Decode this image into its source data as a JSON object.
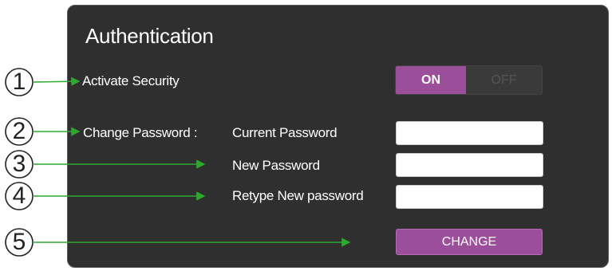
{
  "title": "Authentication",
  "security": {
    "label": "Activate Security",
    "on_label": "ON",
    "off_label": "OFF",
    "state": "on"
  },
  "password": {
    "section_label": "Change Password :",
    "current_label": "Current Password",
    "new_label": "New Password",
    "retype_label": "Retype New password",
    "current_value": "",
    "new_value": "",
    "retype_value": ""
  },
  "change_button": "CHANGE",
  "callouts": [
    "1",
    "2",
    "3",
    "4",
    "5"
  ],
  "colors": {
    "accent": "#9b4f9b",
    "panel": "#2f2f2f",
    "arrow": "#2ea82e"
  }
}
